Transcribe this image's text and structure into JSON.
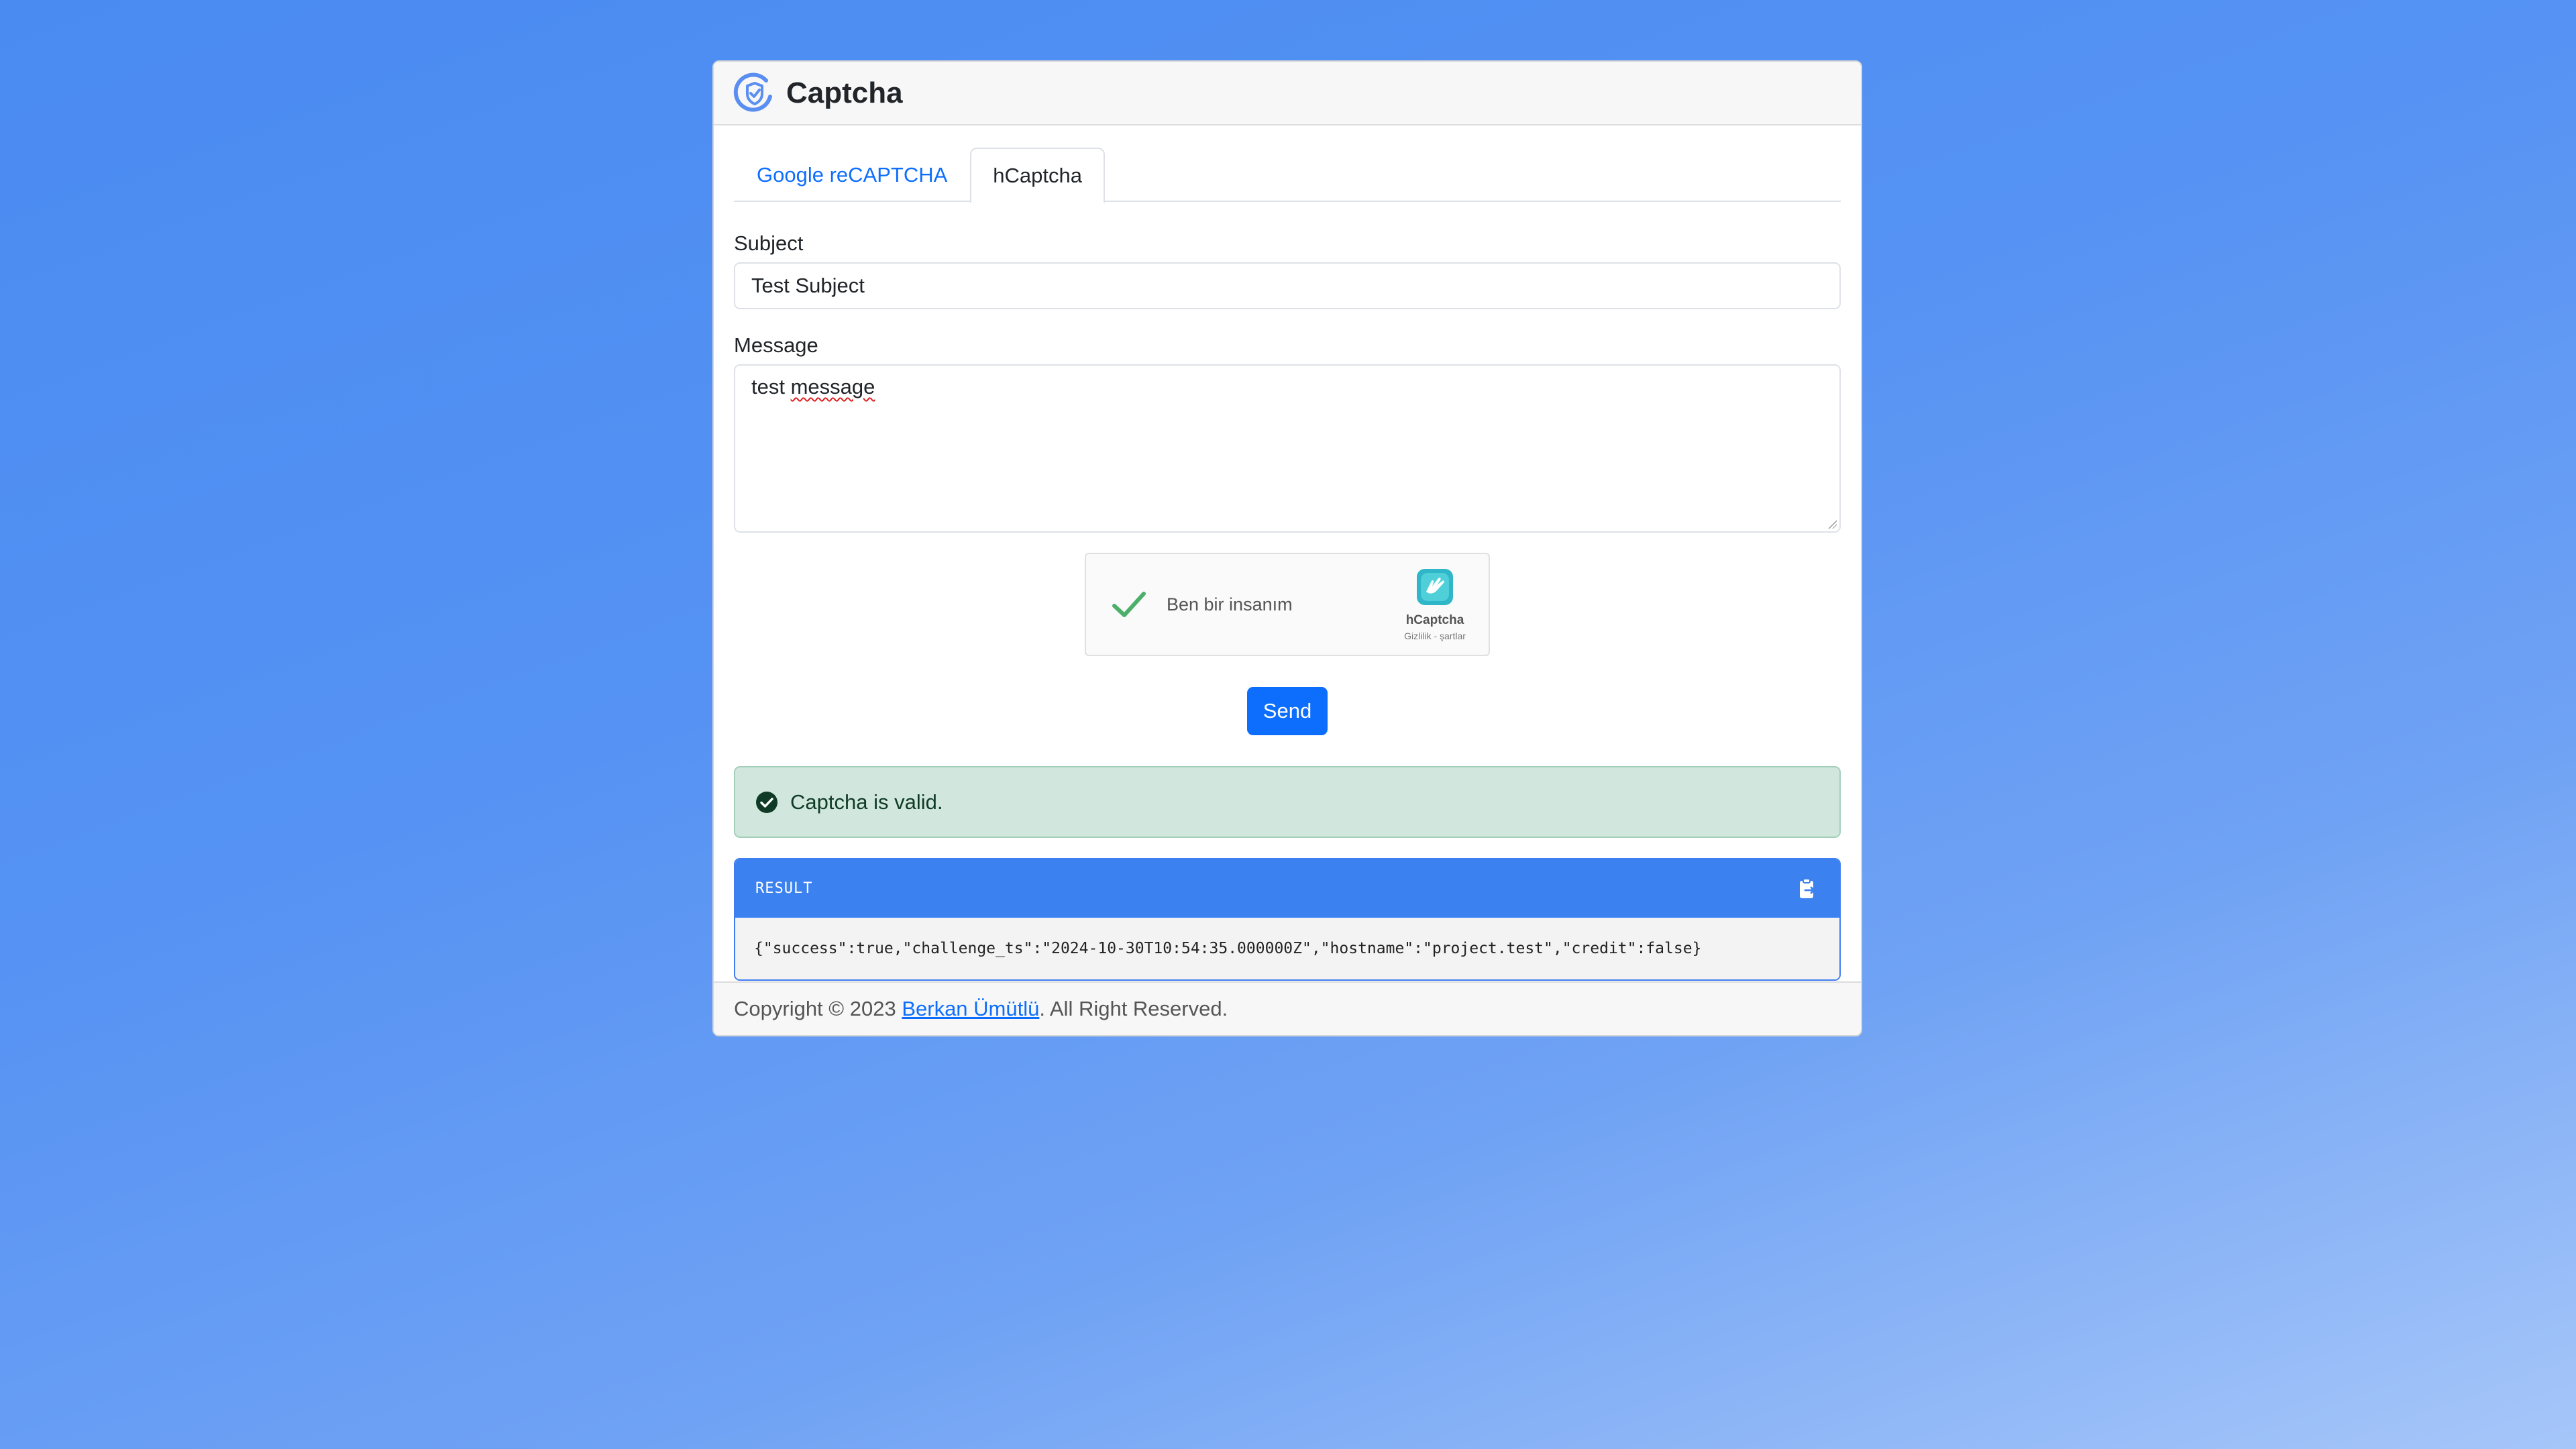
{
  "header": {
    "title": "Captcha",
    "logo_icon": "captcha-shield-icon"
  },
  "tabs": [
    {
      "label": "Google reCAPTCHA",
      "active": false
    },
    {
      "label": "hCaptcha",
      "active": true
    }
  ],
  "form": {
    "subject_label": "Subject",
    "subject_value": "Test Subject",
    "message_label": "Message",
    "message_value_plain": "test ",
    "message_value_misspelled": "message"
  },
  "captcha": {
    "label": "Ben bir insanım",
    "brand": "hCaptcha",
    "links": "Gizlilik - şartlar",
    "checked": true
  },
  "send_button": {
    "label": "Send"
  },
  "alert": {
    "text": "Captcha is valid.",
    "status": "success"
  },
  "result": {
    "title": "RESULT",
    "json": "{\"success\":true,\"challenge_ts\":\"2024-10-30T10:54:35.000000Z\",\"hostname\":\"project.test\",\"credit\":false}"
  },
  "footer": {
    "prefix": "Copyright © 2023 ",
    "author": "Berkan Ümütlü",
    "suffix": ". All Right Reserved."
  },
  "colors": {
    "primary": "#0d6efd",
    "success_bg": "#d1e7dd",
    "result_header": "#3b82f0",
    "page_bg": "#4a8bf2"
  }
}
